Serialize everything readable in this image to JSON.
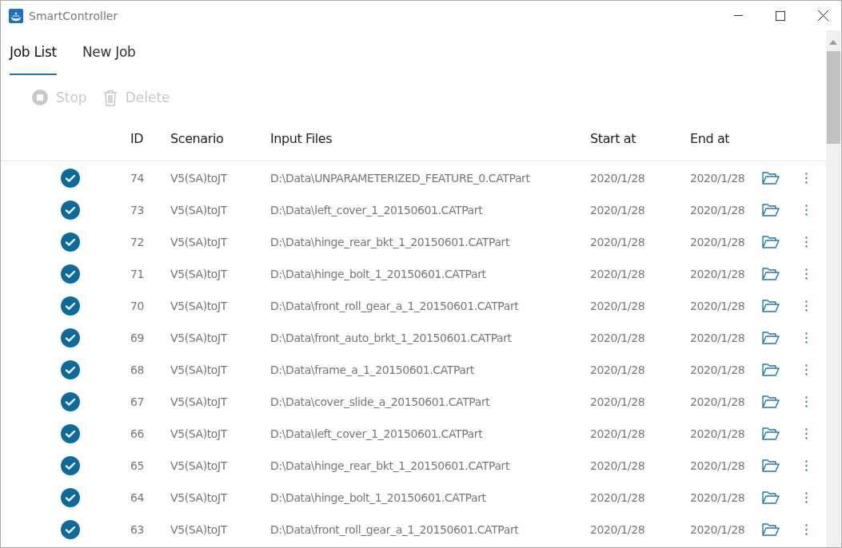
{
  "window": {
    "title": "SmartController"
  },
  "tabs": [
    {
      "label": "Job List",
      "selected": true
    },
    {
      "label": "New Job",
      "selected": false
    }
  ],
  "toolbar": [
    {
      "kind": "stop",
      "label": "Stop",
      "disabled": true
    },
    {
      "kind": "delete",
      "label": "Delete",
      "disabled": true
    }
  ],
  "table": {
    "columns": [
      "ID",
      "Scenario",
      "Input Files",
      "Start at",
      "End at"
    ],
    "rows": [
      {
        "kind": "done",
        "id": "74",
        "scenario": "V5(SA)toJT",
        "input": "D:\\Data\\UNPARAMETERIZED_FEATURE_0.CATPart",
        "start": "2020/1/28",
        "end": "2020/1/28"
      },
      {
        "kind": "done",
        "id": "73",
        "scenario": "V5(SA)toJT",
        "input": "D:\\Data\\left_cover_1_20150601.CATPart",
        "start": "2020/1/28",
        "end": "2020/1/28"
      },
      {
        "kind": "done",
        "id": "72",
        "scenario": "V5(SA)toJT",
        "input": "D:\\Data\\hinge_rear_bkt_1_20150601.CATPart",
        "start": "2020/1/28",
        "end": "2020/1/28"
      },
      {
        "kind": "done",
        "id": "71",
        "scenario": "V5(SA)toJT",
        "input": "D:\\Data\\hinge_bolt_1_20150601.CATPart",
        "start": "2020/1/28",
        "end": "2020/1/28"
      },
      {
        "kind": "done",
        "id": "70",
        "scenario": "V5(SA)toJT",
        "input": "D:\\Data\\front_roll_gear_a_1_20150601.CATPart",
        "start": "2020/1/28",
        "end": "2020/1/28"
      },
      {
        "kind": "done",
        "id": "69",
        "scenario": "V5(SA)toJT",
        "input": "D:\\Data\\front_auto_brkt_1_20150601.CATPart",
        "start": "2020/1/28",
        "end": "2020/1/28"
      },
      {
        "kind": "done",
        "id": "68",
        "scenario": "V5(SA)toJT",
        "input": "D:\\Data\\frame_a_1_20150601.CATPart",
        "start": "2020/1/28",
        "end": "2020/1/28"
      },
      {
        "kind": "done",
        "id": "67",
        "scenario": "V5(SA)toJT",
        "input": "D:\\Data\\cover_slide_a_20150601.CATPart",
        "start": "2020/1/28",
        "end": "2020/1/28"
      },
      {
        "kind": "done",
        "id": "66",
        "scenario": "V5(SA)toJT",
        "input": "D:\\Data\\left_cover_1_20150601.CATPart",
        "start": "2020/1/28",
        "end": "2020/1/28"
      },
      {
        "kind": "done",
        "id": "65",
        "scenario": "V5(SA)toJT",
        "input": "D:\\Data\\hinge_rear_bkt_1_20150601.CATPart",
        "start": "2020/1/28",
        "end": "2020/1/28"
      },
      {
        "kind": "done",
        "id": "64",
        "scenario": "V5(SA)toJT",
        "input": "D:\\Data\\hinge_bolt_1_20150601.CATPart",
        "start": "2020/1/28",
        "end": "2020/1/28"
      },
      {
        "kind": "done",
        "id": "63",
        "scenario": "V5(SA)toJT",
        "input": "D:\\Data\\front_roll_gear_a_1_20150601.CATPart",
        "start": "2020/1/28",
        "end": "2020/1/28"
      }
    ]
  }
}
